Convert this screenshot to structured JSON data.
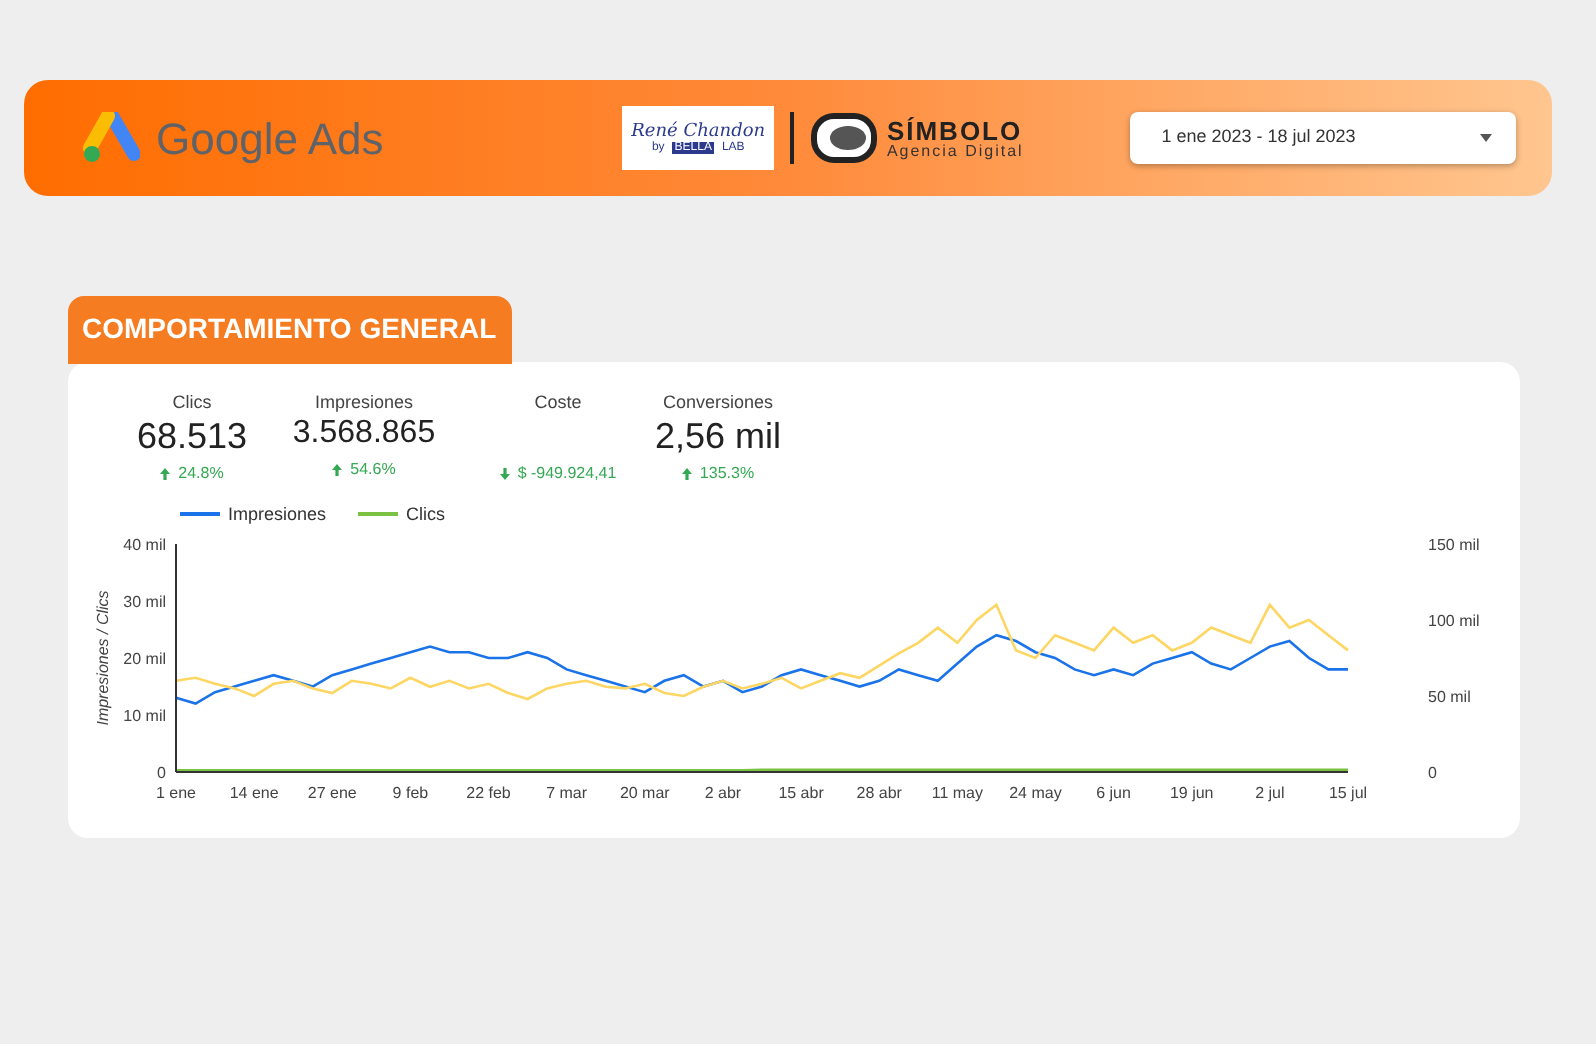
{
  "header": {
    "brand": "Google Ads",
    "partner_logo": {
      "name": "René Chandon",
      "by": "by",
      "lab_box": "BELLA",
      "lab": "LAB"
    },
    "agency_logo": {
      "name": "SÍMBOLO",
      "tagline": "Agencia Digital"
    },
    "date_range": {
      "value": "1 ene 2023 - 18 jul 2023"
    }
  },
  "section": {
    "title": "COMPORTAMIENTO GENERAL",
    "kpis": [
      {
        "label": "Clics",
        "value": "68.513",
        "delta": "24.8%",
        "increase": true,
        "emphasized": true
      },
      {
        "label": "Impresiones",
        "value": "3.568.865",
        "delta": "54.6%",
        "increase": true,
        "emphasized": false
      },
      {
        "label": "Coste",
        "delta": "$ -949.924,41",
        "increase": false
      },
      {
        "label": "Conversiones",
        "value": "2,56 mil",
        "delta": "135.3%",
        "increase": true,
        "emphasized": true
      }
    ],
    "chart": {
      "chart_data": {
        "type": "line",
        "ylabel": "Impresiones / Clics",
        "categories": [
          "1 ene",
          null,
          null,
          null,
          "14 ene",
          null,
          null,
          null,
          "27 ene",
          null,
          null,
          null,
          "9 feb",
          null,
          null,
          null,
          "22 feb",
          null,
          null,
          null,
          "7 mar",
          null,
          null,
          null,
          "20 mar",
          null,
          null,
          null,
          "2 abr",
          null,
          null,
          null,
          "15 abr",
          null,
          null,
          null,
          "28 abr",
          null,
          null,
          null,
          "11 may",
          null,
          null,
          null,
          "24 may",
          null,
          null,
          null,
          "6 jun",
          null,
          null,
          null,
          "19 jun",
          null,
          null,
          null,
          "2 jul",
          null,
          null,
          null,
          "15 jul"
        ],
        "ylim": [
          0,
          40
        ],
        "yticks": [
          {
            "value": 0,
            "label": "0"
          },
          {
            "value": 10,
            "label": "10 mil"
          },
          {
            "value": 20,
            "label": "20 mil"
          },
          {
            "value": 30,
            "label": "30 mil"
          },
          {
            "value": 40,
            "label": "40 mil"
          }
        ],
        "y2lim": [
          0,
          150
        ],
        "y2ticks": [
          {
            "value": 150,
            "label": "150 mil"
          },
          {
            "value": 100,
            "label": "100 mil"
          },
          {
            "value": 50,
            "label": "50 mil"
          },
          {
            "value": 0,
            "label": "0"
          }
        ],
        "series": [
          {
            "name": "Impresiones",
            "color": "#1a73e8",
            "values": [
              13,
              12,
              14,
              15,
              16,
              17,
              16,
              15,
              17,
              18,
              19,
              20,
              21,
              22,
              21,
              21,
              20,
              20,
              21,
              20,
              18,
              17,
              16,
              15,
              14,
              16,
              17,
              15,
              16,
              14,
              15,
              17,
              18,
              17,
              16,
              15,
              16,
              18,
              17,
              16,
              19,
              22,
              24,
              23,
              21,
              20,
              18,
              17,
              18,
              17,
              19,
              20,
              21,
              19,
              18,
              20,
              22,
              23,
              20,
              18,
              18
            ]
          },
          {
            "color": "#fdd663",
            "axis": "y2",
            "values": [
              60,
              62,
              58,
              55,
              50,
              58,
              60,
              55,
              52,
              60,
              58,
              55,
              62,
              56,
              60,
              55,
              58,
              52,
              48,
              55,
              58,
              60,
              56,
              55,
              58,
              52,
              50,
              56,
              60,
              55,
              58,
              62,
              55,
              60,
              65,
              62,
              70,
              78,
              85,
              95,
              85,
              100,
              110,
              80,
              75,
              90,
              85,
              80,
              95,
              85,
              90,
              80,
              85,
              95,
              90,
              85,
              110,
              95,
              100,
              90,
              80
            ]
          },
          {
            "name": "Clics",
            "color": "#7cc242",
            "values": [
              0.3,
              0.3,
              0.3,
              0.3,
              0.3,
              0.3,
              0.3,
              0.3,
              0.3,
              0.3,
              0.3,
              0.3,
              0.3,
              0.3,
              0.3,
              0.3,
              0.3,
              0.3,
              0.3,
              0.3,
              0.3,
              0.3,
              0.3,
              0.3,
              0.3,
              0.3,
              0.3,
              0.3,
              0.3,
              0.3,
              0.4,
              0.4,
              0.4,
              0.4,
              0.4,
              0.4,
              0.4,
              0.4,
              0.4,
              0.4,
              0.4,
              0.4,
              0.4,
              0.4,
              0.4,
              0.4,
              0.4,
              0.4,
              0.4,
              0.4,
              0.4,
              0.4,
              0.4,
              0.4,
              0.4,
              0.4,
              0.4,
              0.4,
              0.4,
              0.4,
              0.4
            ]
          }
        ]
      }
    }
  }
}
